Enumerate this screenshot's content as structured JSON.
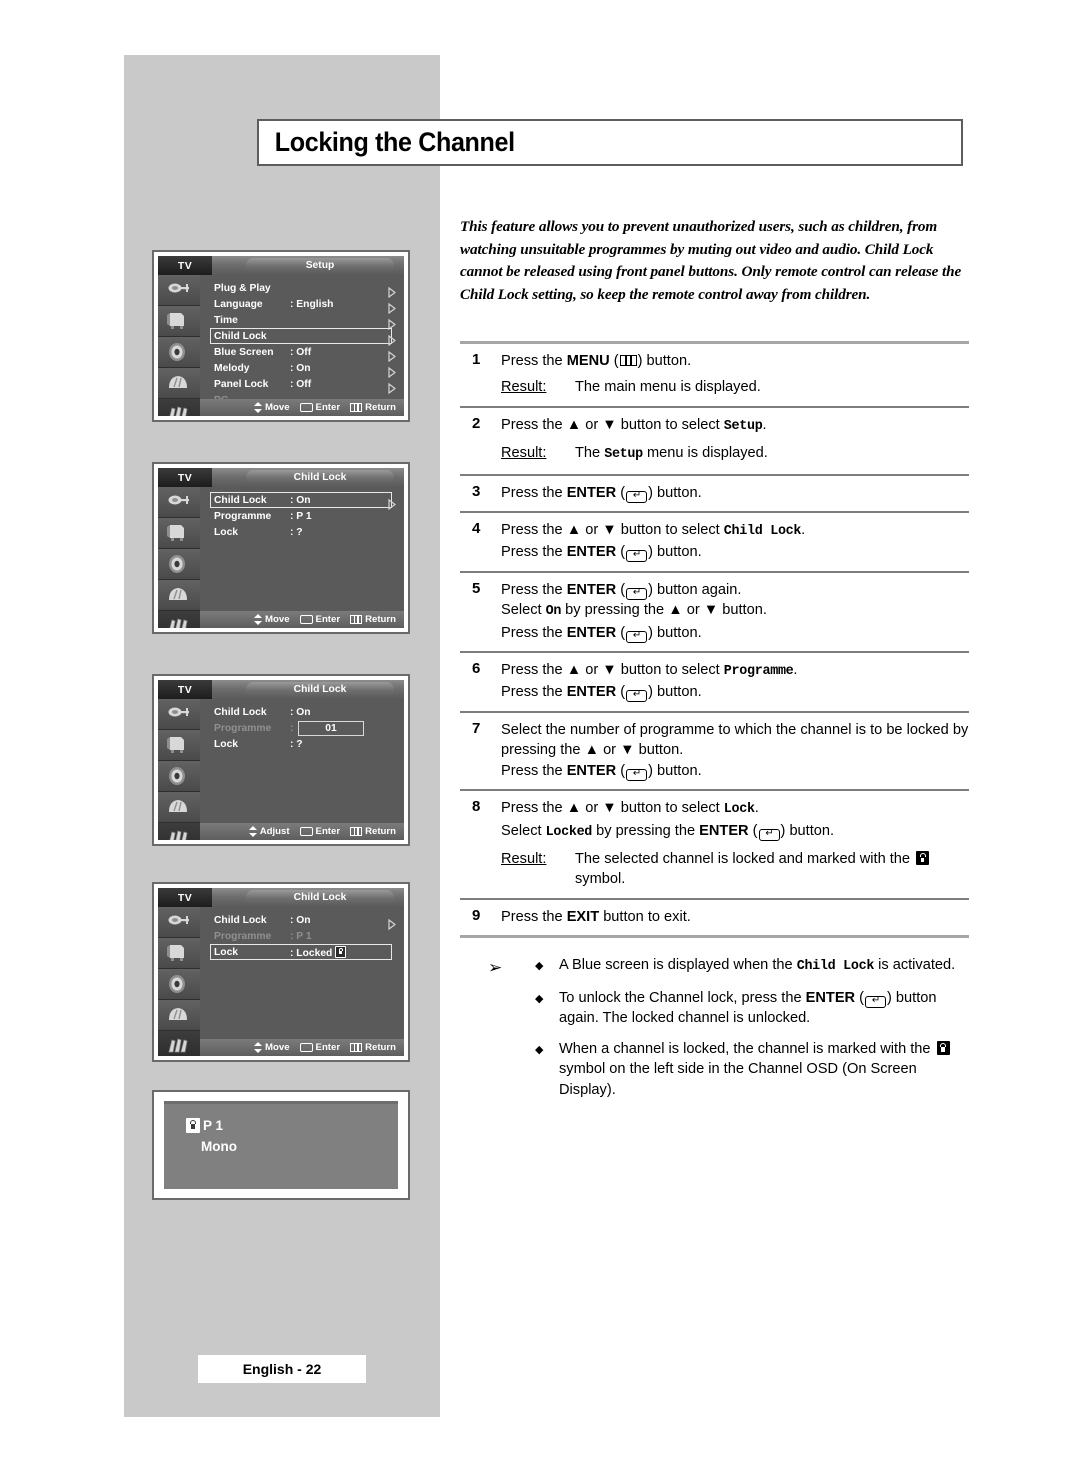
{
  "page": {
    "title": "Locking the Channel",
    "footer": "English - 22",
    "intro": "This feature allows you to prevent unauthorized users, such as children, from watching unsuitable programmes by muting out video and audio. Child Lock cannot be released using front panel buttons. Only remote control can release the Child Lock setting, so keep the remote control away from children."
  },
  "labels": {
    "result": "Result:",
    "press_the": "Press the",
    "button": "button.",
    "or": "or",
    "button_to_select": "button to select"
  },
  "steps": [
    {
      "num": "1",
      "lines": [
        {
          "segments": [
            {
              "t": "Press the ",
              "s": "plain"
            },
            {
              "t": "MENU",
              "s": "bold"
            },
            {
              "t": " (",
              "s": "plain"
            },
            {
              "t": "menu-icon",
              "s": "icon"
            },
            {
              "t": ") button.",
              "s": "plain"
            }
          ]
        }
      ],
      "result": "The main menu is displayed."
    },
    {
      "num": "2",
      "lines": [
        {
          "segments": [
            {
              "t": "Press the ",
              "s": "plain"
            },
            {
              "t": "▲",
              "s": "bold"
            },
            {
              "t": " or ",
              "s": "plain"
            },
            {
              "t": "▼",
              "s": "bold"
            },
            {
              "t": " button to select ",
              "s": "plain"
            },
            {
              "t": "Setup",
              "s": "mono"
            },
            {
              "t": ".",
              "s": "plain"
            }
          ]
        }
      ],
      "result_rich": [
        {
          "t": "The ",
          "s": "plain"
        },
        {
          "t": "Setup",
          "s": "mono"
        },
        {
          "t": " menu is displayed.",
          "s": "plain"
        }
      ]
    },
    {
      "num": "3",
      "lines": [
        {
          "segments": [
            {
              "t": "Press the ",
              "s": "plain"
            },
            {
              "t": "ENTER",
              "s": "bold"
            },
            {
              "t": " (",
              "s": "plain"
            },
            {
              "t": "enter-icon",
              "s": "icon"
            },
            {
              "t": ") button.",
              "s": "plain"
            }
          ]
        }
      ]
    },
    {
      "num": "4",
      "lines": [
        {
          "segments": [
            {
              "t": "Press the ",
              "s": "plain"
            },
            {
              "t": "▲",
              "s": "bold"
            },
            {
              "t": " or ",
              "s": "plain"
            },
            {
              "t": "▼",
              "s": "bold"
            },
            {
              "t": " button to select ",
              "s": "plain"
            },
            {
              "t": "Child Lock",
              "s": "mono"
            },
            {
              "t": ".",
              "s": "plain"
            }
          ]
        },
        {
          "segments": [
            {
              "t": "Press the ",
              "s": "plain"
            },
            {
              "t": "ENTER",
              "s": "bold"
            },
            {
              "t": " (",
              "s": "plain"
            },
            {
              "t": "enter-icon",
              "s": "icon"
            },
            {
              "t": ") button.",
              "s": "plain"
            }
          ]
        }
      ]
    },
    {
      "num": "5",
      "lines": [
        {
          "segments": [
            {
              "t": "Press the ",
              "s": "plain"
            },
            {
              "t": "ENTER",
              "s": "bold"
            },
            {
              "t": " (",
              "s": "plain"
            },
            {
              "t": "enter-icon",
              "s": "icon"
            },
            {
              "t": ") button again.",
              "s": "plain"
            }
          ]
        },
        {
          "segments": [
            {
              "t": "Select ",
              "s": "plain"
            },
            {
              "t": "On",
              "s": "mono"
            },
            {
              "t": " by pressing the ",
              "s": "plain"
            },
            {
              "t": "▲",
              "s": "bold"
            },
            {
              "t": " or ",
              "s": "plain"
            },
            {
              "t": "▼",
              "s": "bold"
            },
            {
              "t": " button.",
              "s": "plain"
            }
          ]
        },
        {
          "segments": [
            {
              "t": "Press the ",
              "s": "plain"
            },
            {
              "t": "ENTER",
              "s": "bold"
            },
            {
              "t": " (",
              "s": "plain"
            },
            {
              "t": "enter-icon",
              "s": "icon"
            },
            {
              "t": ") button.",
              "s": "plain"
            }
          ]
        }
      ]
    },
    {
      "num": "6",
      "lines": [
        {
          "segments": [
            {
              "t": "Press the ",
              "s": "plain"
            },
            {
              "t": "▲",
              "s": "bold"
            },
            {
              "t": " or ",
              "s": "plain"
            },
            {
              "t": "▼",
              "s": "bold"
            },
            {
              "t": " button to select ",
              "s": "plain"
            },
            {
              "t": "Programme",
              "s": "mono"
            },
            {
              "t": ".",
              "s": "plain"
            }
          ]
        },
        {
          "segments": [
            {
              "t": "Press the ",
              "s": "plain"
            },
            {
              "t": "ENTER",
              "s": "bold"
            },
            {
              "t": " (",
              "s": "plain"
            },
            {
              "t": "enter-icon",
              "s": "icon"
            },
            {
              "t": ") button.",
              "s": "plain"
            }
          ]
        }
      ]
    },
    {
      "num": "7",
      "lines": [
        {
          "segments": [
            {
              "t": "Select the number of programme to which the channel is to be locked by pressing the ",
              "s": "plain"
            },
            {
              "t": "▲",
              "s": "bold"
            },
            {
              "t": " or ",
              "s": "plain"
            },
            {
              "t": "▼",
              "s": "bold"
            },
            {
              "t": " button.",
              "s": "plain"
            }
          ]
        },
        {
          "segments": [
            {
              "t": "Press the ",
              "s": "plain"
            },
            {
              "t": "ENTER",
              "s": "bold"
            },
            {
              "t": " (",
              "s": "plain"
            },
            {
              "t": "enter-icon",
              "s": "icon"
            },
            {
              "t": ") button.",
              "s": "plain"
            }
          ]
        }
      ]
    },
    {
      "num": "8",
      "lines": [
        {
          "segments": [
            {
              "t": "Press the ",
              "s": "plain"
            },
            {
              "t": "▲",
              "s": "bold"
            },
            {
              "t": " or ",
              "s": "plain"
            },
            {
              "t": "▼",
              "s": "bold"
            },
            {
              "t": " button to select ",
              "s": "plain"
            },
            {
              "t": "Lock",
              "s": "mono"
            },
            {
              "t": ".",
              "s": "plain"
            }
          ]
        },
        {
          "segments": [
            {
              "t": "Select ",
              "s": "plain"
            },
            {
              "t": "Locked",
              "s": "mono"
            },
            {
              "t": " by pressing the ",
              "s": "plain"
            },
            {
              "t": "ENTER",
              "s": "bold"
            },
            {
              "t": " (",
              "s": "plain"
            },
            {
              "t": "enter-icon",
              "s": "icon"
            },
            {
              "t": ") button.",
              "s": "plain"
            }
          ]
        }
      ],
      "result_rich": [
        {
          "t": "The selected channel is locked and marked with the ",
          "s": "plain"
        },
        {
          "t": "lock-icon",
          "s": "icon"
        },
        {
          "t": " symbol.",
          "s": "plain"
        }
      ]
    },
    {
      "num": "9",
      "lines": [
        {
          "segments": [
            {
              "t": "Press the ",
              "s": "plain"
            },
            {
              "t": "EXIT",
              "s": "bold"
            },
            {
              "t": " button to exit.",
              "s": "plain"
            }
          ]
        }
      ]
    }
  ],
  "notes": {
    "arrow_glyph": "➢",
    "bullet_glyph": "◆",
    "items": [
      [
        {
          "t": "A Blue screen is displayed when the ",
          "s": "plain"
        },
        {
          "t": "Child Lock",
          "s": "mono"
        },
        {
          "t": " is activated.",
          "s": "plain"
        }
      ],
      [
        {
          "t": "To unlock the Channel lock, press the ",
          "s": "plain"
        },
        {
          "t": "ENTER",
          "s": "bold"
        },
        {
          "t": " (",
          "s": "plain"
        },
        {
          "t": "enter-icon",
          "s": "icon"
        },
        {
          "t": ") button again. The locked channel is unlocked.",
          "s": "plain"
        }
      ],
      [
        {
          "t": "When a channel is locked, the channel is marked with the ",
          "s": "plain"
        },
        {
          "t": "lock-icon",
          "s": "icon"
        },
        {
          "t": " symbol on the left side in the Channel OSD (On Screen Display).",
          "s": "plain"
        }
      ]
    ]
  },
  "osd_common": {
    "tv_label": "TV",
    "bottom_move": "Move",
    "bottom_adjust": "Adjust",
    "bottom_enter": "Enter",
    "bottom_return": "Return",
    "sidebar_icons": [
      "antenna-icon",
      "picture-tube-icon",
      "speaker-icon",
      "feature-icon",
      "setup-icon"
    ]
  },
  "osd_panels": [
    {
      "id": "setup-menu",
      "tab": "Setup",
      "bottom_first": "Move",
      "active_icon_index": 4,
      "rows": [
        {
          "label": "Plug & Play",
          "value": "",
          "arrow": "hollow",
          "highlight": false,
          "dim": false
        },
        {
          "label": "Language",
          "value": ": English",
          "arrow": "hollow",
          "highlight": false,
          "dim": false
        },
        {
          "label": "Time",
          "value": "",
          "arrow": "hollow",
          "highlight": false,
          "dim": false
        },
        {
          "label": "Child Lock",
          "value": "",
          "arrow": "hollow",
          "highlight": true,
          "dim": false
        },
        {
          "label": "Blue Screen",
          "value": ": Off",
          "arrow": "hollow",
          "highlight": false,
          "dim": false
        },
        {
          "label": "Melody",
          "value": ": On",
          "arrow": "hollow",
          "highlight": false,
          "dim": false
        },
        {
          "label": "Panel Lock",
          "value": ": Off",
          "arrow": "hollow",
          "highlight": false,
          "dim": false
        },
        {
          "label": "PC",
          "value": "",
          "arrow": "solid",
          "highlight": false,
          "dim": true
        }
      ]
    },
    {
      "id": "child-lock-menu-1",
      "tab": "Child Lock",
      "bottom_first": "Move",
      "active_icon_index": 4,
      "rows": [
        {
          "label": "Child Lock",
          "value": ": On",
          "arrow": "hollow",
          "highlight": true,
          "dim": false
        },
        {
          "label": "Programme",
          "value": ": P   1",
          "arrow": "none",
          "highlight": false,
          "dim": false
        },
        {
          "label": "Lock",
          "value": ": ?",
          "arrow": "none",
          "highlight": false,
          "dim": false
        }
      ]
    },
    {
      "id": "child-lock-menu-2",
      "tab": "Child Lock",
      "bottom_first": "Adjust",
      "active_icon_index": 4,
      "rows": [
        {
          "label": "Child Lock",
          "value": ": On",
          "arrow": "none",
          "highlight": false,
          "dim": false
        },
        {
          "label": "Programme",
          "value": ":",
          "arrow": "none",
          "highlight": false,
          "dim": true,
          "valuebox": "01"
        },
        {
          "label": "Lock",
          "value": ": ?",
          "arrow": "none",
          "highlight": false,
          "dim": false
        }
      ]
    },
    {
      "id": "child-lock-menu-3",
      "tab": "Child Lock",
      "bottom_first": "Move",
      "active_icon_index": 4,
      "rows": [
        {
          "label": "Child Lock",
          "value": ": On",
          "arrow": "hollow",
          "highlight": false,
          "dim": false
        },
        {
          "label": "Programme",
          "value": ": P   1",
          "arrow": "none",
          "highlight": false,
          "dim": true
        },
        {
          "label": "Lock",
          "value": ": Locked",
          "arrow": "none",
          "highlight": true,
          "dim": false,
          "locksym": true
        }
      ]
    }
  ],
  "channel_osd": {
    "lock_icon": "lock-icon",
    "programme": "P  1",
    "sound_mode": "Mono"
  },
  "colors": {
    "page_bg": "#ffffff",
    "band_gray": "#c9c9c9",
    "osd_body": "#5a5a5a",
    "osd_border": "#6a6a6a",
    "rule": "#a6a6a6"
  }
}
